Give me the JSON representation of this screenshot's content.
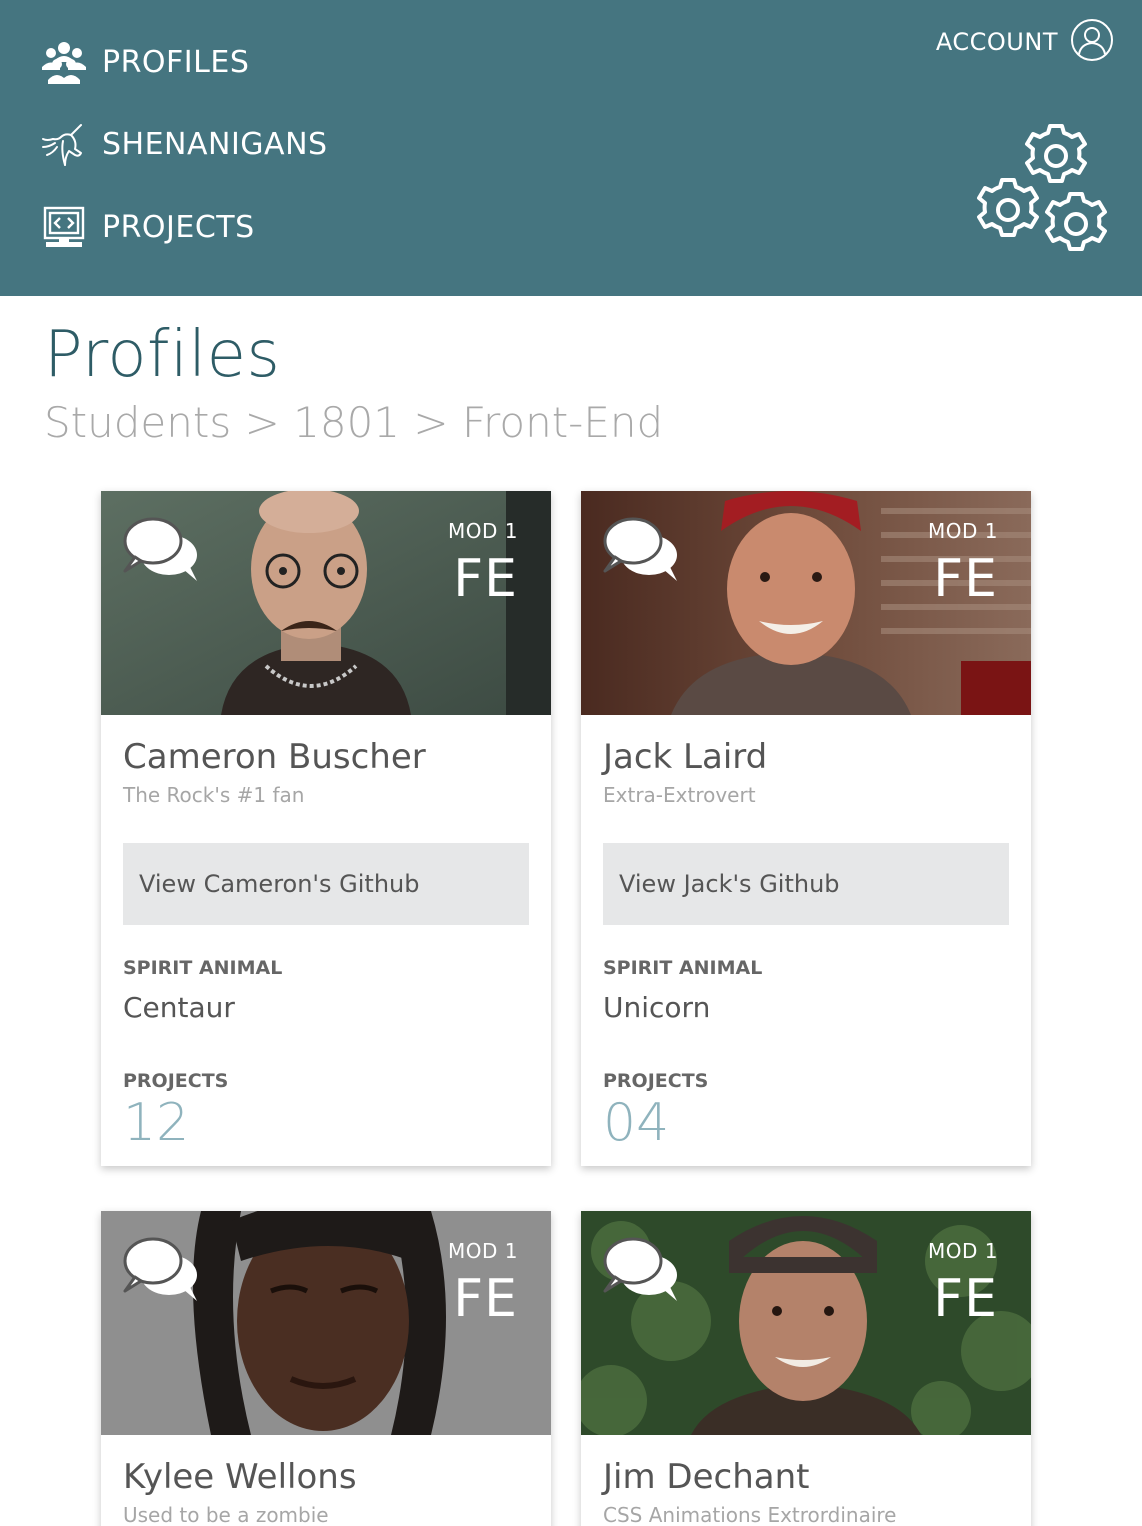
{
  "nav": {
    "items": [
      {
        "label": "PROFILES",
        "icon": "people-group-icon"
      },
      {
        "label": "SHENANIGANS",
        "icon": "unicorn-icon"
      },
      {
        "label": "PROJECTS",
        "icon": "computer-code-icon"
      }
    ],
    "account_label": "ACCOUNT",
    "account_icon": "user-circle-icon",
    "settings_icon": "gears-icon"
  },
  "page": {
    "title": "Profiles",
    "breadcrumb": [
      "Students",
      ">",
      "1801",
      ">",
      "Front-End"
    ]
  },
  "colors": {
    "header_bg": "#457580",
    "title": "#2e5c66",
    "project_count": "#8fb3bd",
    "button_bg": "#e6e7e8"
  },
  "labels": {
    "spirit_animal": "SPIRIT ANIMAL",
    "projects": "PROJECTS"
  },
  "profiles": [
    {
      "mod": "MOD 1",
      "program": "FE",
      "name": "Cameron Buscher",
      "tagline": "The Rock's #1 fan",
      "github_label": "View Cameron's Github",
      "spirit_animal": "Centaur",
      "projects": "12"
    },
    {
      "mod": "MOD 1",
      "program": "FE",
      "name": "Jack Laird",
      "tagline": "Extra-Extrovert",
      "github_label": "View Jack's Github",
      "spirit_animal": "Unicorn",
      "projects": "04"
    },
    {
      "mod": "MOD 1",
      "program": "FE",
      "name": "Kylee Wellons",
      "tagline": "Used to be a zombie"
    },
    {
      "mod": "MOD 1",
      "program": "FE",
      "name": "Jim Dechant",
      "tagline": "CSS Animations Extrordinaire"
    }
  ]
}
